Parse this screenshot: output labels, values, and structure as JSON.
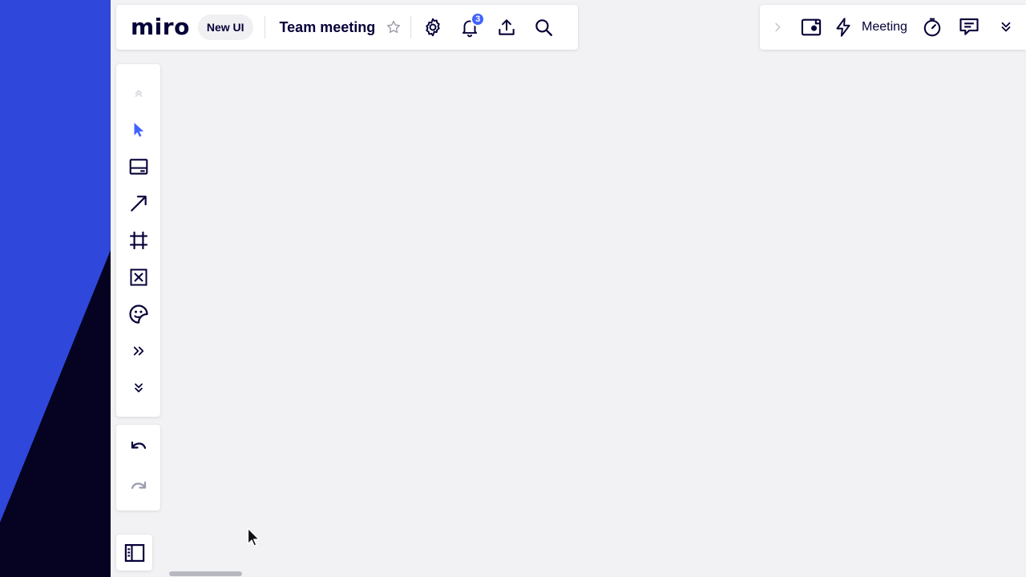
{
  "colors": {
    "brand_blue": "#2f47da",
    "dark_navy": "#050038",
    "accent": "#4262ff",
    "canvas": "#f2f2f4"
  },
  "header": {
    "logo": "miro",
    "badge": "New UI",
    "board_name": "Team meeting",
    "icons": [
      "star-icon",
      "gear-icon",
      "bell-icon",
      "upload-icon",
      "search-icon"
    ],
    "notification_count": "3"
  },
  "right_bar": {
    "icons": [
      "chevron-right-icon",
      "video-icon",
      "lightning-icon",
      "timer-icon",
      "comment-icon",
      "chevron-double-down-icon"
    ],
    "meeting_label": "Meeting"
  },
  "toolbar": {
    "tools": [
      "collapse-up-icon",
      "select-icon",
      "card-icon",
      "arrow-line-icon",
      "frame-icon",
      "image-placeholder-icon",
      "sticker-icon",
      "more-tools-icon",
      "expand-down-icon"
    ],
    "history": [
      "undo-icon",
      "redo-icon"
    ],
    "panel": "frames-panel-icon"
  }
}
